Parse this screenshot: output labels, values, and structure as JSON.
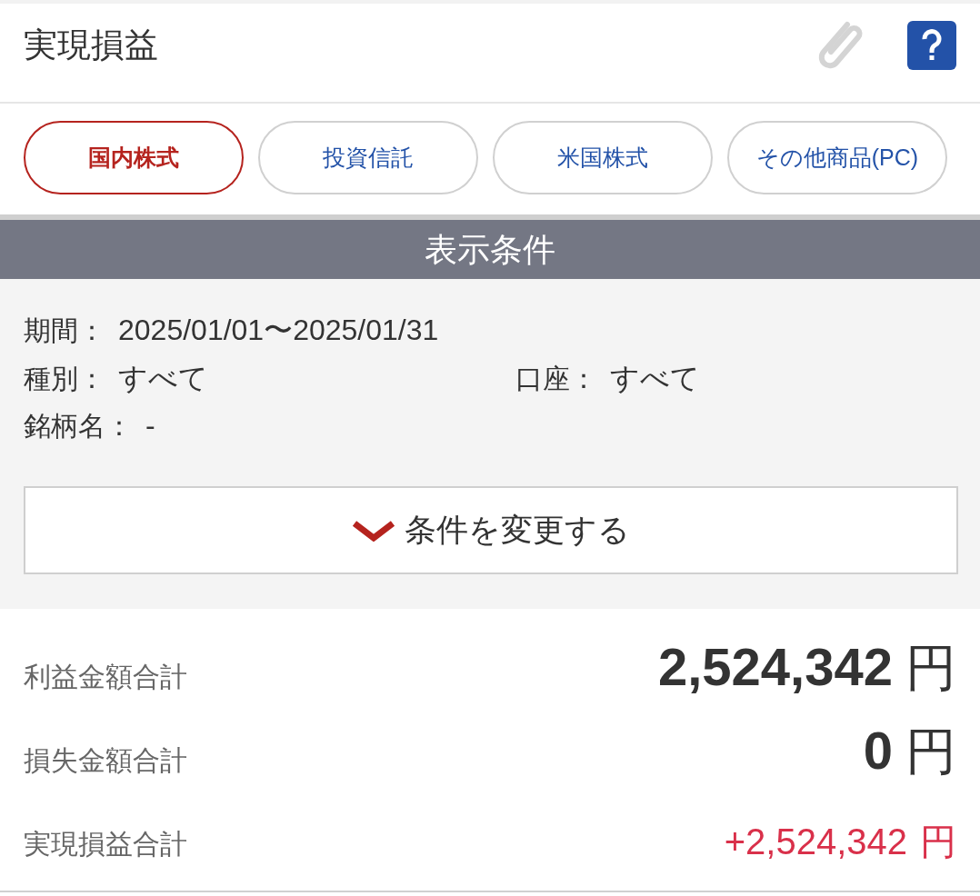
{
  "header": {
    "title": "実現損益"
  },
  "tabs": [
    {
      "label": "国内株式",
      "selected": true
    },
    {
      "label": "投資信託",
      "selected": false
    },
    {
      "label": "米国株式",
      "selected": false
    },
    {
      "label": "その他商品(PC)",
      "selected": false
    }
  ],
  "conditions": {
    "title": "表示条件",
    "rows": [
      [
        {
          "label": "期間：",
          "value": "2025/01/01〜2025/01/31"
        }
      ],
      [
        {
          "label": "種別：",
          "value": "すべて"
        },
        {
          "label": "口座：",
          "value": "すべて"
        }
      ],
      [
        {
          "label": "銘柄名：",
          "value": "-"
        }
      ]
    ],
    "change_button": "条件を変更する"
  },
  "summary": [
    {
      "kind": "large",
      "label": "利益金額合計",
      "value": "2,524,342",
      "unit": "円"
    },
    {
      "kind": "large",
      "label": "損失金額合計",
      "value": "0",
      "unit": "円"
    },
    {
      "kind": "signed",
      "label": "実現損益合計",
      "value": "+2,524,342",
      "unit": "円"
    }
  ]
}
